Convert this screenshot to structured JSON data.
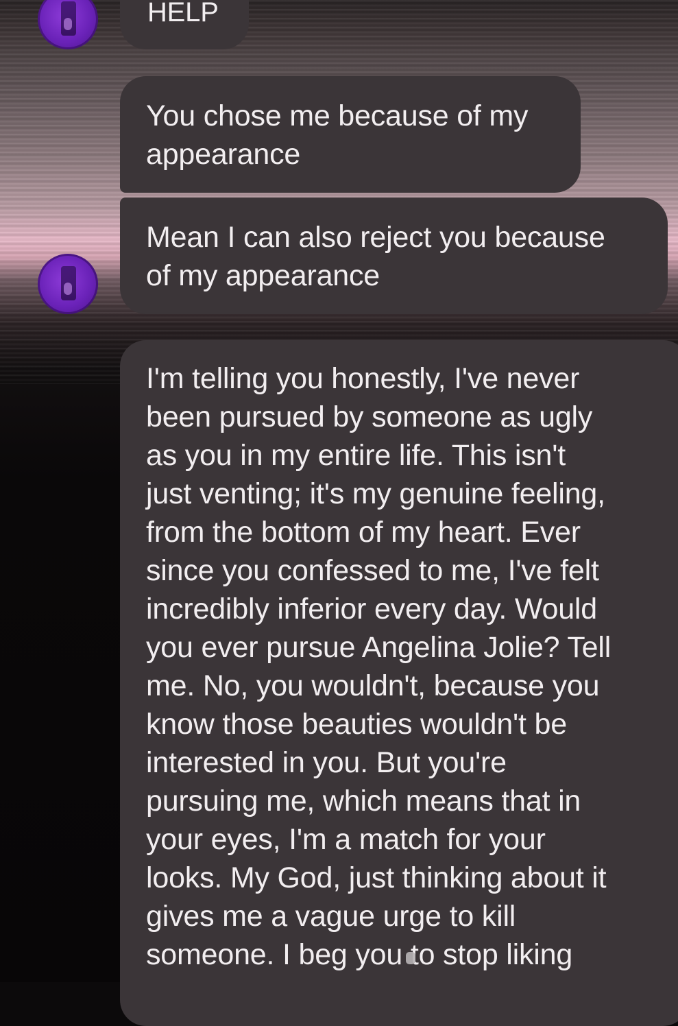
{
  "chat": {
    "messages": [
      {
        "text": "HELP"
      },
      {
        "text": "You chose me because of my\nappearance"
      },
      {
        "text": "Mean I can also reject you because\nof my appearance"
      },
      {
        "text": "I'm telling you honestly, I've never\nbeen pursued by someone as ugly\nas you in my entire life. This isn't\njust venting; it's my genuine feeling,\nfrom the bottom of my heart. Ever\nsince you confessed to me, I've felt\nincredibly inferior every day. Would\nyou ever pursue Angelina Jolie? Tell\nme. No, you wouldn't, because you\nknow those beauties wouldn't be\ninterested in you. But you're\npursuing me, which means that in\nyour eyes, I'm a match for your\nlooks. My God, just thinking about it\ngives me a vague urge to kill\nsomeone. I beg you to stop liking"
      }
    ]
  },
  "colors": {
    "bubble": "#3b3538",
    "text": "#f2eef0",
    "avatar": "#7a2fcc"
  },
  "icons": {
    "avatar": "contact-avatar-icon"
  }
}
